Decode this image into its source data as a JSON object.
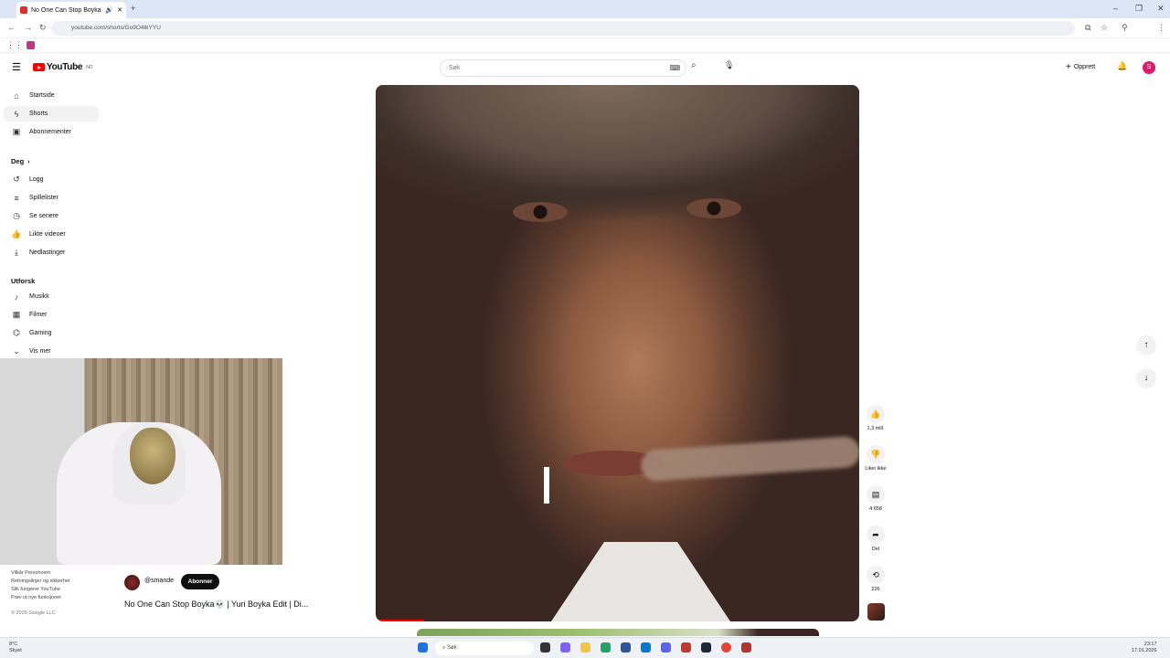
{
  "browser": {
    "tab_title": "No One Can Stop Boyka 👀",
    "url": "youtube.com/shorts/Go9O4tkYYU"
  },
  "header": {
    "logo_text": "YouTube",
    "logo_region": "NO",
    "search_placeholder": "Søk",
    "create_label": "Opprett",
    "avatar_letter": "S"
  },
  "sidebar": {
    "main": [
      {
        "icon": "home-icon",
        "label": "Startside"
      },
      {
        "icon": "shorts-icon",
        "label": "Shorts"
      },
      {
        "icon": "subscriptions-icon",
        "label": "Abonnementer"
      }
    ],
    "you_heading": "Deg",
    "you_items": [
      {
        "icon": "history-icon",
        "label": "Logg"
      },
      {
        "icon": "playlists-icon",
        "label": "Spillelister"
      },
      {
        "icon": "watch-later-icon",
        "label": "Se senere"
      },
      {
        "icon": "liked-icon",
        "label": "Likte videoer"
      },
      {
        "icon": "download-icon",
        "label": "Nedlastinger"
      }
    ],
    "explore_heading": "Utforsk",
    "explore_items": [
      {
        "icon": "music-icon",
        "label": "Musikk"
      },
      {
        "icon": "film-icon",
        "label": "Filmer"
      },
      {
        "icon": "gaming-icon",
        "label": "Gaming"
      },
      {
        "icon": "show-more-icon",
        "label": "Vis mer"
      }
    ],
    "footer": {
      "line1": "Vilkår  Personvern",
      "line2": "Retningslinjer og sikkerhet",
      "line3": "Slik fungerer YouTube",
      "line4": "Prøv ut nye funksjoner",
      "copyright": "© 2025 Google LLC"
    }
  },
  "short": {
    "channel": "@smande",
    "subscribe_label": "Abonner",
    "title": "No One Can Stop Boyka💀 | Yuri Boyka Edit | Di...",
    "progress": 0.1
  },
  "actions": {
    "likes": "1,3 mill.",
    "dislike_label": "Liker ikke",
    "comments": "4 658",
    "share_label": "Del",
    "remix_count": "226"
  },
  "taskbar": {
    "temp": "8°C",
    "weather": "Skyet",
    "search_label": "Søk",
    "time": "23:17",
    "date": "17.01.2026"
  },
  "colors": {
    "accent_red": "#ff0000",
    "avatar_pink": "#e3196c"
  }
}
